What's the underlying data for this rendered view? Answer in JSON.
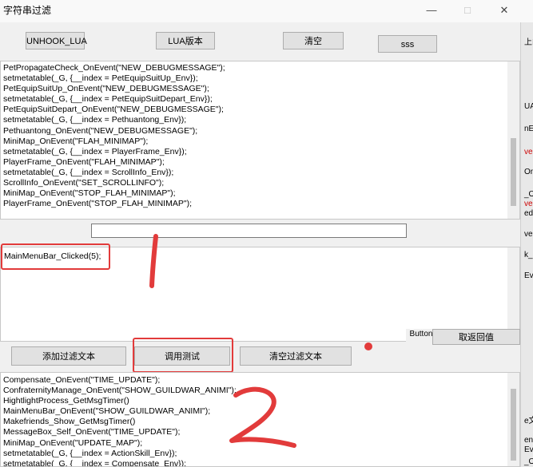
{
  "window": {
    "title": "字符串过滤"
  },
  "toolbar": {
    "unhook": "UNHOOK_LUA",
    "lua_version": "LUA版本",
    "clear": "清空",
    "sss": "sss"
  },
  "log_top": [
    "PetPropagateCheck_OnEvent(\"NEW_DEBUGMESSAGE\");",
    "setmetatable(_G, {__index = PetEquipSuitUp_Env});",
    "PetEquipSuitUp_OnEvent(\"NEW_DEBUGMESSAGE\");",
    "setmetatable(_G, {__index = PetEquipSuitDepart_Env});",
    "PetEquipSuitDepart_OnEvent(\"NEW_DEBUGMESSAGE\");",
    "setmetatable(_G, {__index = Pethuantong_Env});",
    "Pethuantong_OnEvent(\"NEW_DEBUGMESSAGE\");",
    "MiniMap_OnEvent(\"FLAH_MINIMAP\");",
    "setmetatable(_G, {__index = PlayerFrame_Env});",
    "PlayerFrame_OnEvent(\"FLAH_MINIMAP\");",
    "setmetatable(_G, {__index = ScrollInfo_Env});",
    "ScrollInfo_OnEvent(\"SET_SCROLLINFO\");",
    "MiniMap_OnEvent(\"STOP_FLAH_MINIMAP\");",
    "PlayerFrame_OnEvent(\"STOP_FLAH_MINIMAP\");"
  ],
  "filter_input": {
    "value": ""
  },
  "script_editor": {
    "text": "MainMenuBar_Clicked(5);"
  },
  "side_buttons": {
    "button": "Button",
    "return_value": "取返回值"
  },
  "actions": {
    "add_filter": "添加过滤文本",
    "call_test": "调用测试",
    "clear_filter": "清空过滤文本"
  },
  "log_bottom": [
    "Compensate_OnEvent(\"TIME_UPDATE\");",
    "ConfraternityManage_OnEvent(\"SHOW_GUILDWAR_ANIMI\");",
    "HightlightProcess_GetMsgTimer()",
    "MainMenuBar_OnEvent(\"SHOW_GUILDWAR_ANIMI\");",
    "Makefriends_Show_GetMsgTimer()",
    "MessageBox_Self_OnEvent(\"TIME_UPDATE\");",
    "MiniMap_OnEvent(\"UPDATE_MAP\");",
    "setmetatable(_G, {__index = ActionSkill_Env});",
    "setmetatable(_G, {__index = Compensate_Env});"
  ],
  "annotations": {
    "one": "1",
    "two": "2"
  },
  "background_window": {
    "fragments": [
      "上I",
      "UA",
      "nE",
      "ven",
      "On",
      "_O",
      "ven",
      "ed",
      "ve",
      "k_C",
      "Ev",
      "e文",
      "en",
      "Ev",
      "_O"
    ]
  },
  "colors": {
    "annotation_red": "#e23b3b"
  }
}
